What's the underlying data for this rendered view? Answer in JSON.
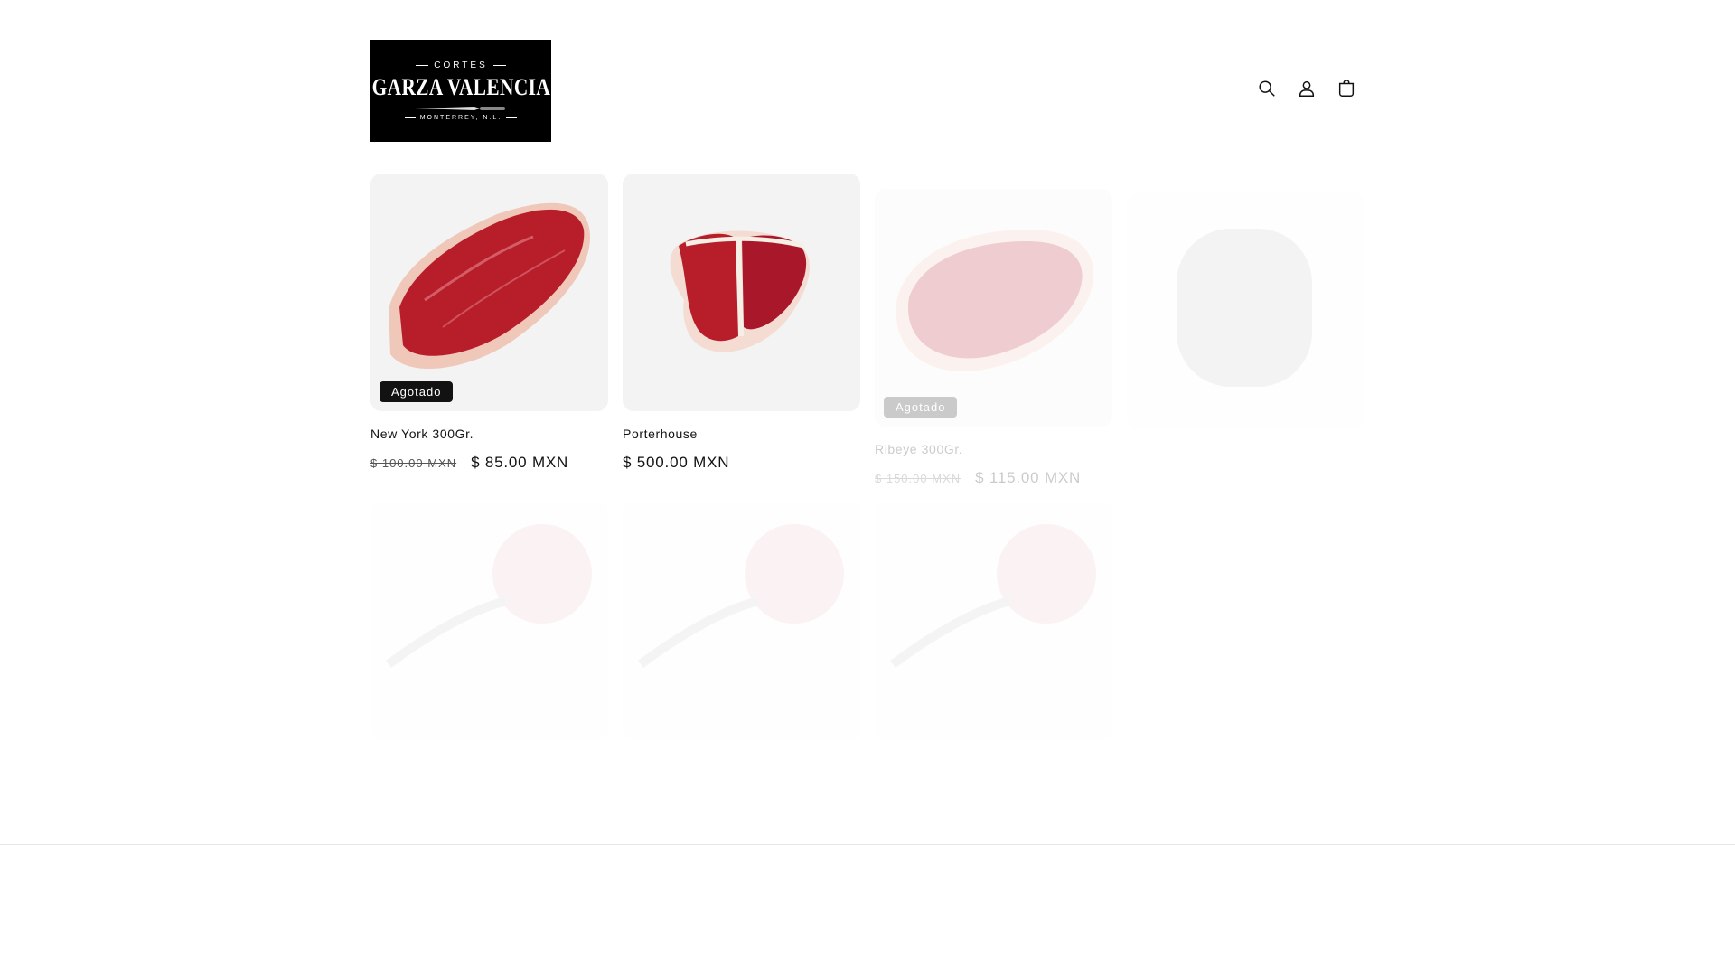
{
  "header": {
    "logo": {
      "top": "CORTES",
      "main": "GARZA VALENCIA",
      "sub": "MONTERREY, N.L."
    },
    "icons": [
      "search-icon",
      "account-icon",
      "cart-icon"
    ]
  },
  "products": [
    {
      "title": "New York 300Gr.",
      "badge": "Agotado",
      "old_price": "$ 100.00 MXN",
      "price": "$ 85.00 MXN"
    },
    {
      "title": "Porterhouse",
      "badge": "",
      "old_price": "",
      "price": "$ 500.00 MXN"
    },
    {
      "title": "Ribeye 300Gr.",
      "badge": "Agotado",
      "old_price": "$ 150.00 MXN",
      "price": "$ 115.00 MXN"
    }
  ],
  "colors": {
    "accent": "#121212",
    "badge_text": "#ffffff",
    "meat": "#b81d2a",
    "fat": "#f2d2c4"
  }
}
